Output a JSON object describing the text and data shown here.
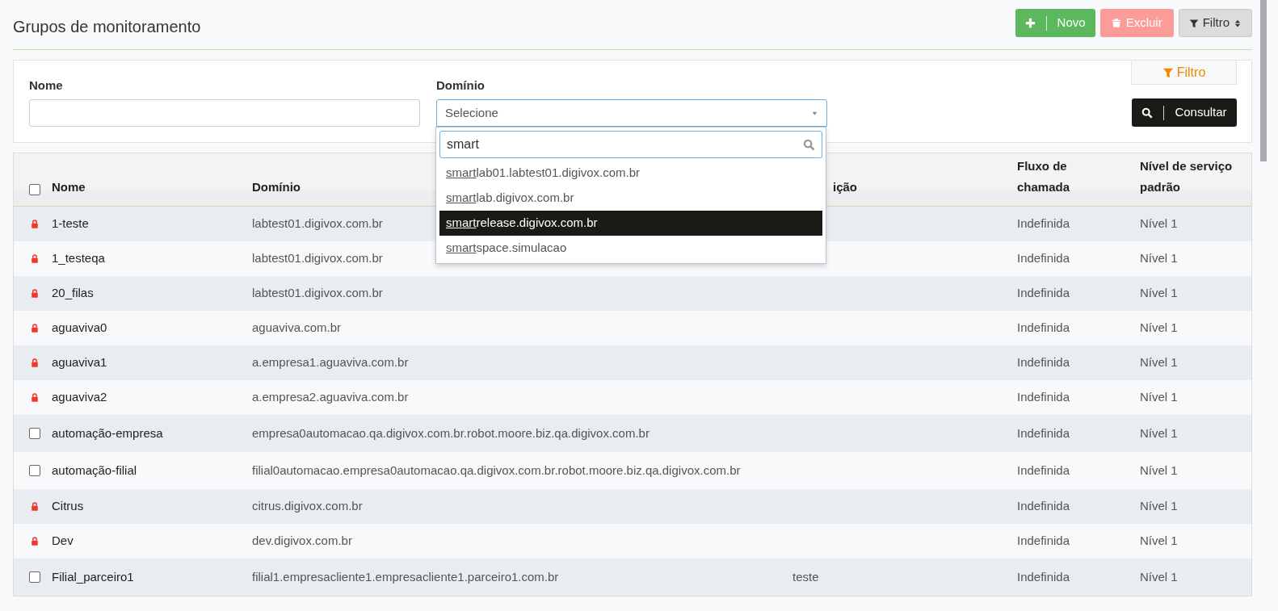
{
  "page": {
    "title": "Grupos de monitoramento"
  },
  "toolbar": [
    {
      "kind": "new",
      "label": "Novo"
    },
    {
      "kind": "delete",
      "label": "Excluir",
      "disabled": true
    },
    {
      "kind": "filter",
      "label": "Filtro"
    }
  ],
  "filter_panel": {
    "tab": "Filtro",
    "fields": [
      {
        "label": "Nome",
        "kind": "text"
      },
      {
        "label": "Domínio",
        "kind": "select",
        "value": "Selecione"
      }
    ],
    "submit": "Consultar"
  },
  "dropdown": {
    "search": "smart",
    "options": [
      {
        "match": "smart",
        "rest": "lab01.labtest01.digivox.com.br",
        "selected": false
      },
      {
        "match": "smart",
        "rest": "lab.digivox.com.br",
        "selected": false
      },
      {
        "match": "smart",
        "rest": "release.digivox.com.br",
        "selected": true
      },
      {
        "match": "smart",
        "rest": "space.simulacao",
        "selected": false
      }
    ]
  },
  "table": {
    "select_all": {
      "checked": false
    },
    "columns": [
      "Nome",
      "Domínio",
      "ição",
      "Fluxo de chamada",
      "Nível de serviço padrão"
    ],
    "rows": [
      {
        "kind": "locked",
        "name": "1-teste",
        "domain": "labtest01.digivox.com.br",
        "flow": "Indefinida",
        "level": "Nível 1"
      },
      {
        "kind": "locked",
        "name": "1_testeqa",
        "domain": "labtest01.digivox.com.br",
        "flow": "Indefinida",
        "level": "Nível 1"
      },
      {
        "kind": "locked",
        "name": "20_filas",
        "domain": "labtest01.digivox.com.br",
        "flow": "Indefinida",
        "level": "Nível 1"
      },
      {
        "kind": "locked",
        "name": "aguaviva0",
        "domain": "aguaviva.com.br",
        "flow": "Indefinida",
        "level": "Nível 1"
      },
      {
        "kind": "locked",
        "name": "aguaviva1",
        "domain": "a.empresa1.aguaviva.com.br",
        "flow": "Indefinida",
        "level": "Nível 1"
      },
      {
        "kind": "locked",
        "name": "aguaviva2",
        "domain": "a.empresa2.aguaviva.com.br",
        "flow": "Indefinida",
        "level": "Nível 1"
      },
      {
        "kind": "selectable",
        "checked": false,
        "name": "automação-empresa",
        "domain": "empresa0automacao.qa.digivox.com.br.robot.moore.biz.qa.digivox.com.br",
        "flow": "Indefinida",
        "level": "Nível 1"
      },
      {
        "kind": "selectable",
        "checked": false,
        "name": "automação-filial",
        "domain": "filial0automacao.empresa0automacao.qa.digivox.com.br.robot.moore.biz.qa.digivox.com.br",
        "flow": "Indefinida",
        "level": "Nível 1"
      },
      {
        "kind": "locked",
        "name": "Citrus",
        "domain": "citrus.digivox.com.br",
        "flow": "Indefinida",
        "level": "Nível 1"
      },
      {
        "kind": "locked",
        "name": "Dev",
        "domain": "dev.digivox.com.br",
        "flow": "Indefinida",
        "level": "Nível 1"
      },
      {
        "kind": "selectable",
        "checked": false,
        "name": "Filial_parceiro1",
        "domain": "filial1.empresacliente1.empresacliente1.parceiro1.com.br",
        "description": "teste",
        "flow": "Indefinida",
        "level": "Nível 1"
      }
    ]
  }
}
